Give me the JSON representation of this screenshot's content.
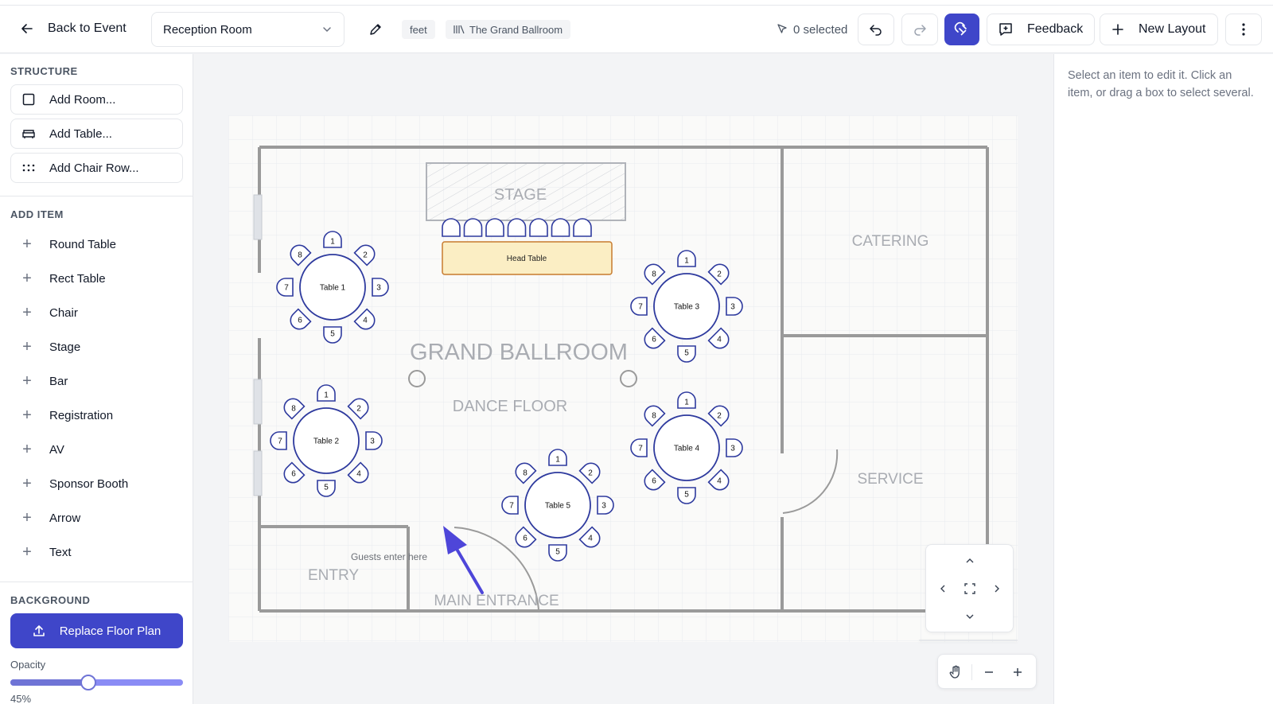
{
  "topbar": {
    "back_label": "Back to Event",
    "layout_select": "Reception Room",
    "units_tag": "feet",
    "venue_tag": "The Grand Ballroom",
    "selected_count": "0 selected",
    "feedback_label": "Feedback",
    "new_layout_label": "New Layout"
  },
  "sidebar": {
    "structure_heading": "STRUCTURE",
    "structure_items": [
      "Add Room...",
      "Add Table...",
      "Add Chair Row..."
    ],
    "add_item_heading": "ADD ITEM",
    "add_items": [
      "Round Table",
      "Rect Table",
      "Chair",
      "Stage",
      "Bar",
      "Registration",
      "AV",
      "Sponsor Booth",
      "Arrow",
      "Text"
    ],
    "background_heading": "BACKGROUND",
    "replace_label": "Replace Floor Plan",
    "opacity_label": "Opacity",
    "opacity_value": "45%",
    "opacity_fraction": 0.45
  },
  "right_panel": {
    "hint": "Select an item to edit it. Click an item, or drag a box to select several."
  },
  "floorplan": {
    "stage_label": "STAGE",
    "catering_label": "CATERING",
    "ballroom_label": "GRAND BALLROOM",
    "dance_floor_label": "DANCE FLOOR",
    "service_label": "SERVICE",
    "entry_label": "ENTRY",
    "main_entrance_label": "MAIN ENTRANCE",
    "guests_note": "Guests enter here",
    "head_table_label": "Head Table",
    "tables": [
      {
        "label": "Table 1",
        "seats": [
          "1",
          "2",
          "3",
          "4",
          "5",
          "6",
          "7",
          "8"
        ]
      },
      {
        "label": "Table 2",
        "seats": [
          "1",
          "2",
          "3",
          "4",
          "5",
          "6",
          "7",
          "8"
        ]
      },
      {
        "label": "Table 3",
        "seats": [
          "1",
          "2",
          "3",
          "4",
          "5",
          "6",
          "7",
          "8"
        ]
      },
      {
        "label": "Table 4",
        "seats": [
          "1",
          "2",
          "3",
          "4",
          "5",
          "6",
          "7",
          "8"
        ]
      },
      {
        "label": "Table 5",
        "seats": [
          "1",
          "2",
          "3",
          "4",
          "5",
          "6",
          "7",
          "8"
        ]
      }
    ]
  },
  "colors": {
    "accent": "#3f46c9",
    "seat_stroke": "#2e3a9e",
    "head_table_fill": "#fbeec4",
    "head_table_stroke": "#c77b2e",
    "arrow": "#4e46d9"
  }
}
